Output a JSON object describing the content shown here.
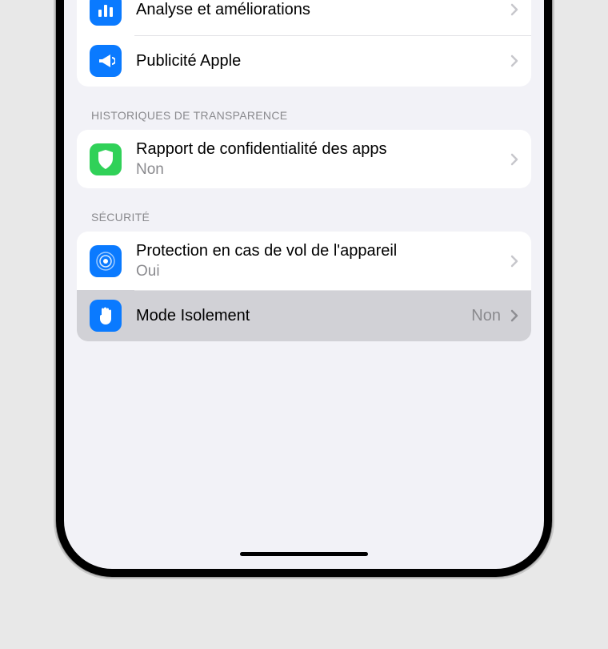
{
  "group_top": {
    "items": [
      {
        "icon": "chart-icon",
        "label": "Analyse et améliorations"
      },
      {
        "icon": "megaphone-icon",
        "label": "Publicité Apple"
      }
    ]
  },
  "group_transparency": {
    "header": "HISTORIQUES DE TRANSPARENCE",
    "items": [
      {
        "icon": "shield-icon",
        "label": "Rapport de confidentialité des apps",
        "sub": "Non"
      }
    ]
  },
  "group_security": {
    "header": "SÉCURITÉ",
    "items": [
      {
        "icon": "ripple-icon",
        "label": "Protection en cas de vol de l'appareil",
        "sub": "Oui"
      },
      {
        "icon": "hand-icon",
        "label": "Mode Isolement",
        "detail": "Non"
      }
    ]
  }
}
